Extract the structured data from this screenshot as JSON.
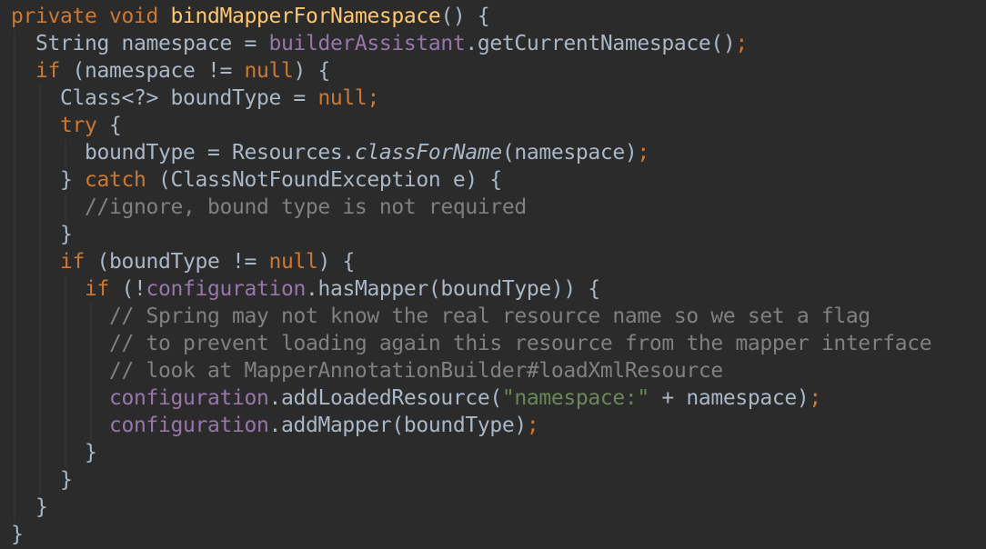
{
  "editor": {
    "colors": {
      "background": "#2b2b2b",
      "text": "#a9b7c6",
      "keyword": "#cc7832",
      "method_decl": "#ffc66d",
      "field": "#9876aa",
      "string": "#6a8759",
      "comment": "#808080"
    },
    "lines": [
      [
        {
          "t": "private",
          "c": "kw"
        },
        {
          "t": " "
        },
        {
          "t": "void",
          "c": "kw"
        },
        {
          "t": " "
        },
        {
          "t": "bindMapperForNamespace",
          "c": "fn"
        },
        {
          "t": "() {"
        }
      ],
      [
        {
          "t": "  String namespace = "
        },
        {
          "t": "builderAssistant",
          "c": "fld"
        },
        {
          "t": ".getCurrentNamespace()"
        },
        {
          "t": ";",
          "c": "kw"
        }
      ],
      [
        {
          "t": "  "
        },
        {
          "t": "if",
          "c": "kw"
        },
        {
          "t": " (namespace != "
        },
        {
          "t": "null",
          "c": "kw"
        },
        {
          "t": ") {"
        }
      ],
      [
        {
          "t": "    Class<?> boundType = "
        },
        {
          "t": "null",
          "c": "kw"
        },
        {
          "t": ";",
          "c": "kw"
        }
      ],
      [
        {
          "t": "    "
        },
        {
          "t": "try",
          "c": "kw"
        },
        {
          "t": " {"
        }
      ],
      [
        {
          "t": "      boundType = Resources."
        },
        {
          "t": "classForName",
          "c": "ital"
        },
        {
          "t": "(namespace)"
        },
        {
          "t": ";",
          "c": "kw"
        }
      ],
      [
        {
          "t": "    } "
        },
        {
          "t": "catch",
          "c": "kw"
        },
        {
          "t": " (ClassNotFoundException e) {"
        }
      ],
      [
        {
          "t": "      "
        },
        {
          "t": "//ignore, bound type is not required",
          "c": "cmt"
        }
      ],
      [
        {
          "t": "    }"
        }
      ],
      [
        {
          "t": "    "
        },
        {
          "t": "if",
          "c": "kw"
        },
        {
          "t": " (boundType != "
        },
        {
          "t": "null",
          "c": "kw"
        },
        {
          "t": ") {"
        }
      ],
      [
        {
          "t": "      "
        },
        {
          "t": "if",
          "c": "kw"
        },
        {
          "t": " (!"
        },
        {
          "t": "configuration",
          "c": "fld"
        },
        {
          "t": ".hasMapper(boundType)) {"
        }
      ],
      [
        {
          "t": "        "
        },
        {
          "t": "// Spring may not know the real resource name so we set a flag",
          "c": "cmt"
        }
      ],
      [
        {
          "t": "        "
        },
        {
          "t": "// to prevent loading again this resource from the mapper interface",
          "c": "cmt"
        }
      ],
      [
        {
          "t": "        "
        },
        {
          "t": "// look at MapperAnnotationBuilder#loadXmlResource",
          "c": "cmt"
        }
      ],
      [
        {
          "t": "        "
        },
        {
          "t": "configuration",
          "c": "fld"
        },
        {
          "t": ".addLoadedResource("
        },
        {
          "t": "\"namespace:\"",
          "c": "str"
        },
        {
          "t": " + namespace)"
        },
        {
          "t": ";",
          "c": "kw"
        }
      ],
      [
        {
          "t": "        "
        },
        {
          "t": "configuration",
          "c": "fld"
        },
        {
          "t": ".addMapper(boundType)"
        },
        {
          "t": ";",
          "c": "kw"
        }
      ],
      [
        {
          "t": "      }"
        }
      ],
      [
        {
          "t": "    }"
        }
      ],
      [
        {
          "t": "  }"
        }
      ],
      [
        {
          "t": "}"
        }
      ]
    ]
  }
}
